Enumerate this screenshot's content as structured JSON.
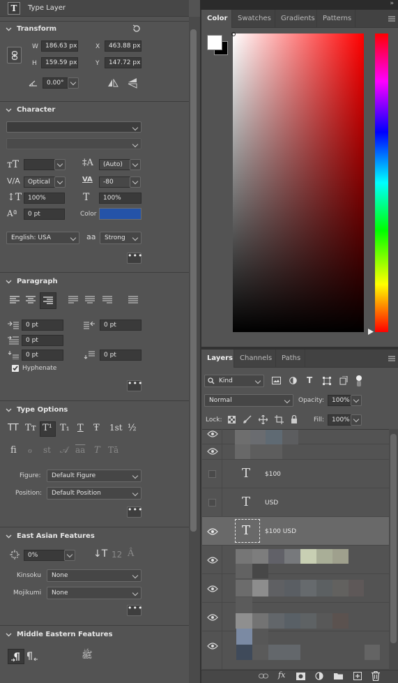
{
  "left_panel": {
    "header_title": "Type Layer",
    "transform": {
      "title": "Transform",
      "w_label": "W",
      "w_value": "186.63 px",
      "x_label": "X",
      "x_value": "463.88 px",
      "h_label": "H",
      "h_value": "159.59 px",
      "y_label": "Y",
      "y_value": "147.72 px",
      "angle_value": "0.00°"
    },
    "character": {
      "title": "Character",
      "font_family": "",
      "font_style": "",
      "font_size": "",
      "leading": "(Auto)",
      "kerning": "Optical",
      "tracking": "-80",
      "vertical_scale": "100%",
      "horizontal_scale": "100%",
      "baseline_shift": "0 pt",
      "color_label": "Color",
      "color_value": "#2453a8",
      "language": "English: USA",
      "anti_alias_label": "aa",
      "anti_alias": "Strong",
      "more_label": "•••"
    },
    "paragraph": {
      "title": "Paragraph",
      "indent_left": "0 pt",
      "indent_right": "0 pt",
      "indent_first": "0 pt",
      "space_before": "0 pt",
      "space_after": "0 pt",
      "hyphenate_label": "Hyphenate",
      "hyphenate_checked": true,
      "more_label": "•••"
    },
    "type_options": {
      "title": "Type Options",
      "row1": [
        "TT",
        "Tт",
        "T¹",
        "T₁",
        "T",
        "Ŧ",
        "1st",
        "½"
      ],
      "row2": [
        "fi",
        "ℴ",
        "st",
        "𝒜",
        "aa",
        "T",
        "Tā"
      ],
      "figure_label": "Figure:",
      "figure_value": "Default Figure",
      "position_label": "Position:",
      "position_value": "Default Position",
      "more_label": "•••"
    },
    "east_asian": {
      "title": "East Asian Features",
      "tsume_value": "0%",
      "kinsoku_label": "Kinsoku",
      "kinsoku_value": "None",
      "mojikumi_label": "Mojikumi",
      "mojikumi_value": "None",
      "more_label": "•••"
    },
    "middle_eastern": {
      "title": "Middle Eastern Features"
    }
  },
  "color_panel": {
    "tabs": [
      "Color",
      "Swatches",
      "Gradients",
      "Patterns"
    ],
    "active_tab": "Color",
    "foreground": "#ffffff",
    "background": "#000000",
    "hue_color": "#ff0000"
  },
  "layers_panel": {
    "tabs": [
      "Layers",
      "Channels",
      "Paths"
    ],
    "active_tab": "Layers",
    "filter_kind": "Kind",
    "blend_mode": "Normal",
    "opacity_label": "Opacity:",
    "opacity_value": "100%",
    "lock_label": "Lock:",
    "fill_label": "Fill:",
    "fill_value": "100%",
    "layers": [
      {
        "name": "",
        "type": "pixel",
        "visible": true
      },
      {
        "name": "",
        "type": "pixel",
        "visible": true
      },
      {
        "name": "$100",
        "type": "text",
        "visible": false
      },
      {
        "name": "USD",
        "type": "text",
        "visible": false
      },
      {
        "name": "$100 USD",
        "type": "text",
        "visible": true,
        "selected": true
      },
      {
        "name": "",
        "type": "pixel",
        "visible": true
      },
      {
        "name": "",
        "type": "pixel",
        "visible": true
      },
      {
        "name": "",
        "type": "pixel",
        "visible": true
      },
      {
        "name": "",
        "type": "pixel",
        "visible": true
      }
    ],
    "footer_fx_label": "fx"
  }
}
